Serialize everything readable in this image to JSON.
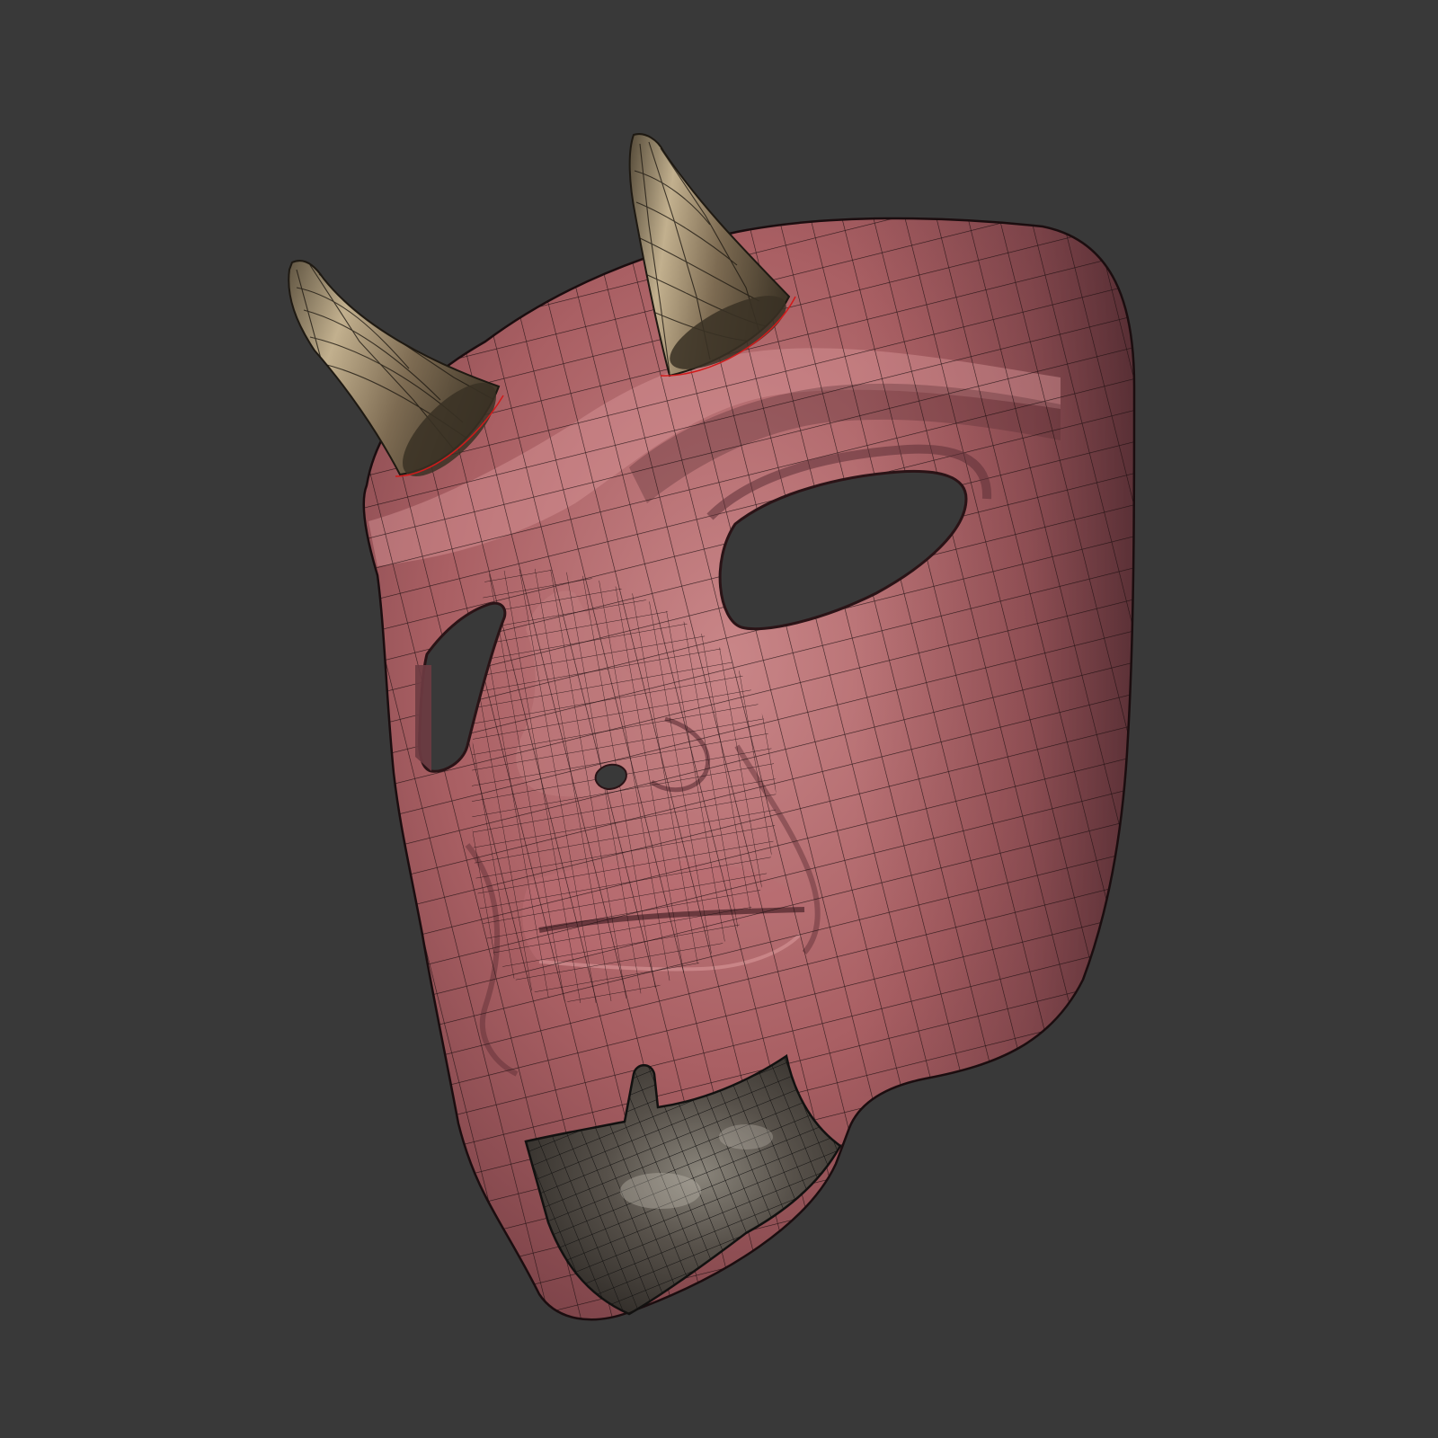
{
  "scene": {
    "subject": "demon-mask-3d-model",
    "render_style": "mesh-wireframe-on-shaded-surface"
  },
  "colors": {
    "background": "#393939",
    "mask_skin": "#a95f63",
    "mask_skin_dark": "#6c393f",
    "mask_skin_light": "#c98688",
    "horn": "#7d6b52",
    "horn_dark": "#3e3527",
    "horn_light": "#c2b08e",
    "chin_guard": "#3f3a33",
    "chin_guard_light": "#8a857b",
    "wire_line": "#1b0d0f",
    "seam_red": "#d11a1a"
  },
  "icons": {
    "horn_left": "horn-icon",
    "horn_right": "horn-icon",
    "eye_hole": "eye-hole-icon",
    "nostril": "nostril-icon",
    "chin_guard": "chin-guard-icon"
  }
}
